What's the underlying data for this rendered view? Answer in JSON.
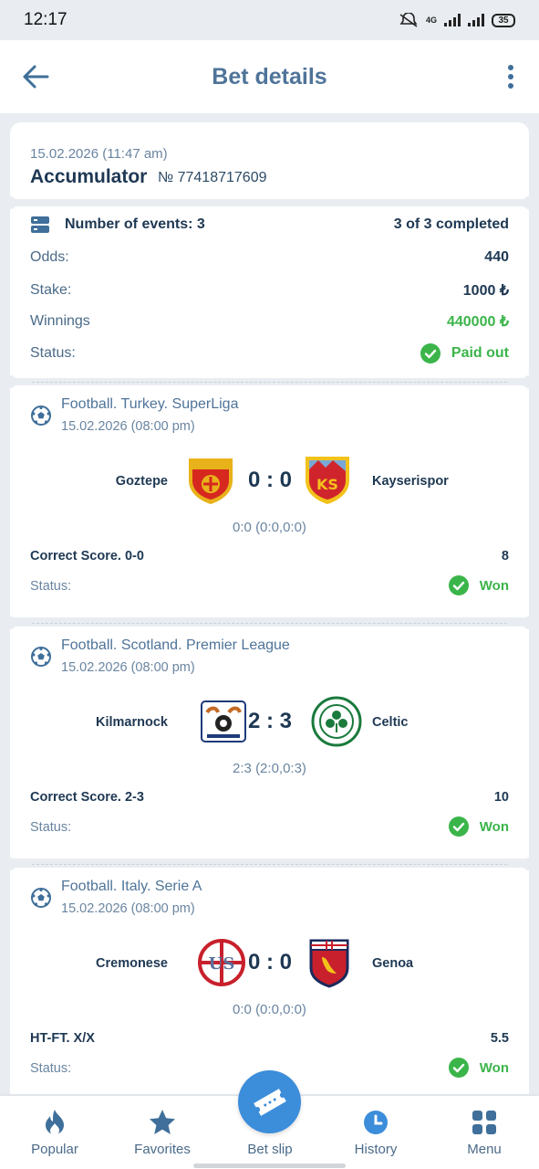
{
  "status_bar": {
    "time": "12:17",
    "network": "4G",
    "battery": "35"
  },
  "header": {
    "title": "Bet details"
  },
  "bet": {
    "date": "15.02.2026 (11:47 am)",
    "type": "Accumulator",
    "number": "№ 77418717609",
    "events_label": "Number of events: 3",
    "completed": "3 of 3 completed",
    "odds_label": "Odds:",
    "odds_value": "440",
    "stake_label": "Stake:",
    "stake_value": "1000 ₺",
    "winnings_label": "Winnings",
    "winnings_value": "440000 ₺",
    "status_label": "Status:",
    "status_value": "Paid out"
  },
  "events": [
    {
      "league": "Football. Turkey. SuperLiga",
      "date": "15.02.2026 (08:00 pm)",
      "home": "Goztepe",
      "away": "Kayserispor",
      "score": "0 : 0",
      "detail": "0:0 (0:0,0:0)",
      "market": "Correct Score. 0-0",
      "odd": "8",
      "status_label": "Status:",
      "status": "Won"
    },
    {
      "league": "Football. Scotland. Premier League",
      "date": "15.02.2026 (08:00 pm)",
      "home": "Kilmarnock",
      "away": "Celtic",
      "score": "2 : 3",
      "detail": "2:3 (2:0,0:3)",
      "market": "Correct Score. 2-3",
      "odd": "10",
      "status_label": "Status:",
      "status": "Won"
    },
    {
      "league": "Football. Italy. Serie A",
      "date": "15.02.2026 (08:00 pm)",
      "home": "Cremonese",
      "away": "Genoa",
      "score": "0 : 0",
      "detail": "0:0 (0:0,0:0)",
      "market": "HT-FT. X/X",
      "odd": "5.5",
      "status_label": "Status:",
      "status": "Won"
    }
  ],
  "nav": {
    "popular": "Popular",
    "favorites": "Favorites",
    "betslip": "Bet slip",
    "history": "History",
    "menu": "Menu"
  },
  "colors": {
    "accent": "#3c8dda",
    "success": "#3bb54a",
    "title": "#4f7499"
  }
}
